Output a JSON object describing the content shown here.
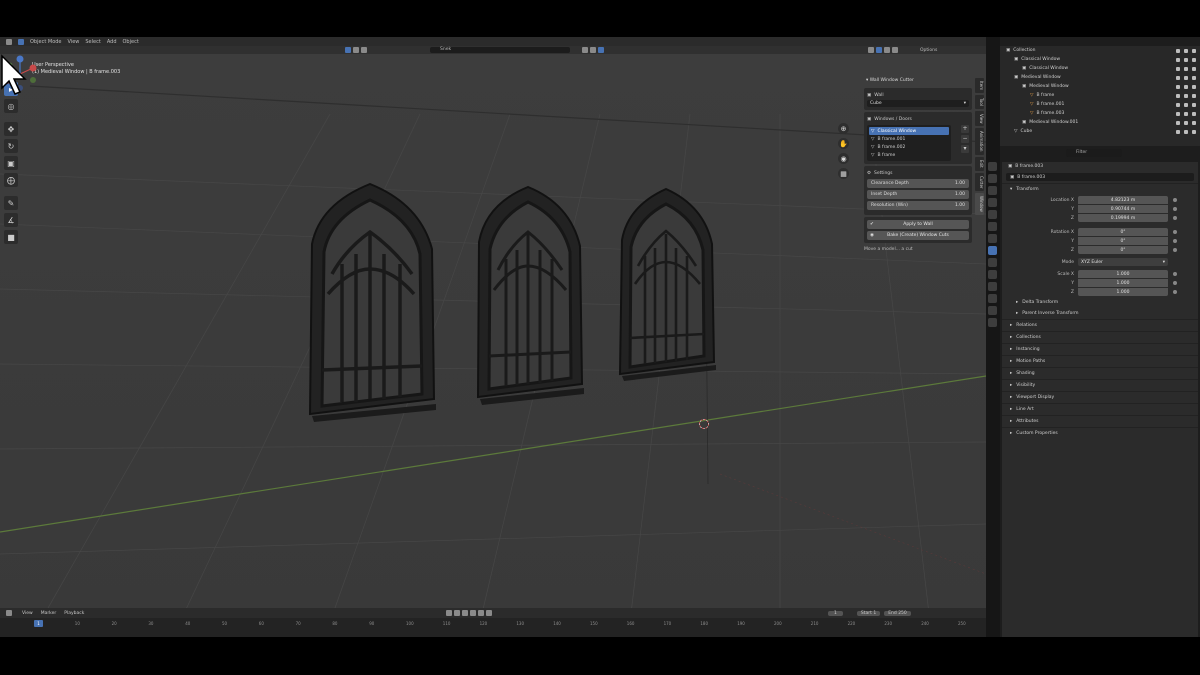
{
  "menubar": {
    "mode": "Object Mode",
    "items": [
      "View",
      "Select",
      "Add",
      "Object"
    ]
  },
  "viewport_header": {
    "orientation": "Global",
    "search_placeholder": "Snek",
    "options": "Options"
  },
  "viewport": {
    "view_name": "User Perspective",
    "collection_line": "(1) Medieval Window | B frame.003"
  },
  "npanel": {
    "title": "Wall Window Cutter",
    "wall_label": "Wall",
    "wall_value": "Cube",
    "windows_label": "Windows / Doors",
    "windows": [
      {
        "label": "Classical Window",
        "selected": true
      },
      {
        "label": "B frame.001",
        "selected": false
      },
      {
        "label": "B frame.002",
        "selected": false
      },
      {
        "label": "B frame",
        "selected": false
      }
    ],
    "settings_label": "Settings",
    "props": [
      {
        "label": "Clearance Depth",
        "value": "1.00"
      },
      {
        "label": "Inset Depth",
        "value": "1.00"
      },
      {
        "label": "Resolution (Win)",
        "value": "1.00"
      }
    ],
    "apply_button": "Apply to Wall",
    "bake_button": "Bake (Create) Window Cuts",
    "hint": "Move a model... a cut"
  },
  "vtabs": [
    "Item",
    "Tool",
    "View",
    "Animation",
    "Edit",
    "Cutter",
    "Window"
  ],
  "timeline": {
    "menus": [
      "View",
      "Marker",
      "Playback"
    ],
    "current_frame": "1",
    "start_label": "Start",
    "start": "1",
    "end_label": "End",
    "end": "250",
    "ticks": [
      "1",
      "10",
      "20",
      "30",
      "40",
      "50",
      "60",
      "70",
      "80",
      "90",
      "100",
      "110",
      "120",
      "130",
      "140",
      "150",
      "160",
      "170",
      "180",
      "190",
      "200",
      "210",
      "220",
      "230",
      "240",
      "250"
    ]
  },
  "outliner": {
    "items": [
      {
        "label": "Collection",
        "indent": 0
      },
      {
        "label": "Classical Window",
        "indent": 1
      },
      {
        "label": "Classical Window",
        "indent": 2
      },
      {
        "label": "Medieval Window",
        "indent": 1
      },
      {
        "label": "Medieval Window",
        "indent": 2
      },
      {
        "label": "B frame",
        "indent": 3
      },
      {
        "label": "B frame.001",
        "indent": 3
      },
      {
        "label": "B frame.003",
        "indent": 3
      },
      {
        "label": "Medieval Window.001",
        "indent": 2
      },
      {
        "label": "Cube",
        "indent": 1
      }
    ],
    "filter_placeholder": "Filter"
  },
  "properties": {
    "object_name": "B frame.003",
    "object_field": "B frame.003",
    "transform_label": "Transform",
    "location_label": "Location X",
    "location": [
      "4.82123 m",
      "0.90744 m",
      "0.19994 m"
    ],
    "rotation_label": "Rotation X",
    "rotation": [
      "0°",
      "0°",
      "0°"
    ],
    "mode_label": "Mode",
    "mode_value": "XYZ Euler",
    "scale_label": "Scale X",
    "scale": [
      "1.000",
      "1.000",
      "1.000"
    ],
    "axis_y": "Y",
    "axis_z": "Z",
    "subsections": [
      "Delta Transform",
      "Parent Inverse Transform"
    ],
    "sections": [
      "Relations",
      "Collections",
      "Instancing",
      "Motion Paths",
      "Shading",
      "Visibility",
      "Viewport Display",
      "Line Art",
      "Attributes",
      "Custom Properties"
    ]
  }
}
